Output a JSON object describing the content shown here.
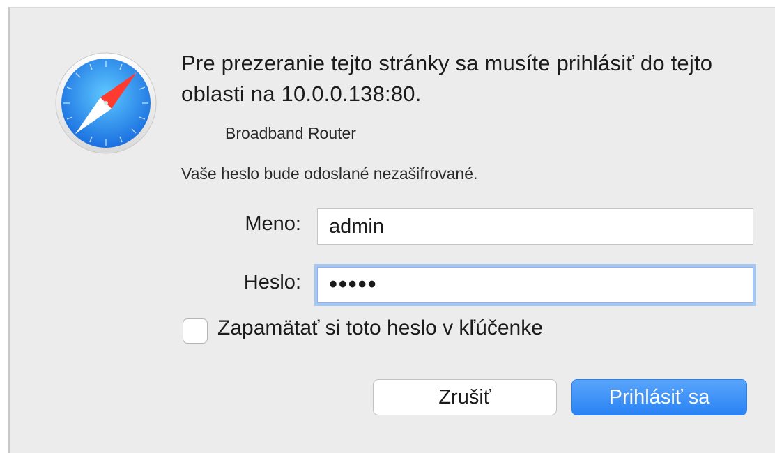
{
  "dialog": {
    "app_icon": "safari-compass-icon",
    "message": "Pre prezeranie tejto stránky sa musíte prihlásiť do tejto oblasti na 10.0.0.138:80.",
    "realm": "Broadband Router",
    "warning": "Vaše heslo bude odoslané nezašifrované.",
    "username_label": "Meno:",
    "username_value": "admin",
    "password_label": "Heslo:",
    "password_value": "•••••",
    "remember_label": "Zapamätať si toto heslo v kľúčenke",
    "remember_checked": false,
    "cancel_label": "Zrušiť",
    "login_label": "Prihlásiť sa"
  },
  "colors": {
    "background": "#ececec",
    "accent": "#2a83f4",
    "focus_ring": "#a6c6f3"
  }
}
